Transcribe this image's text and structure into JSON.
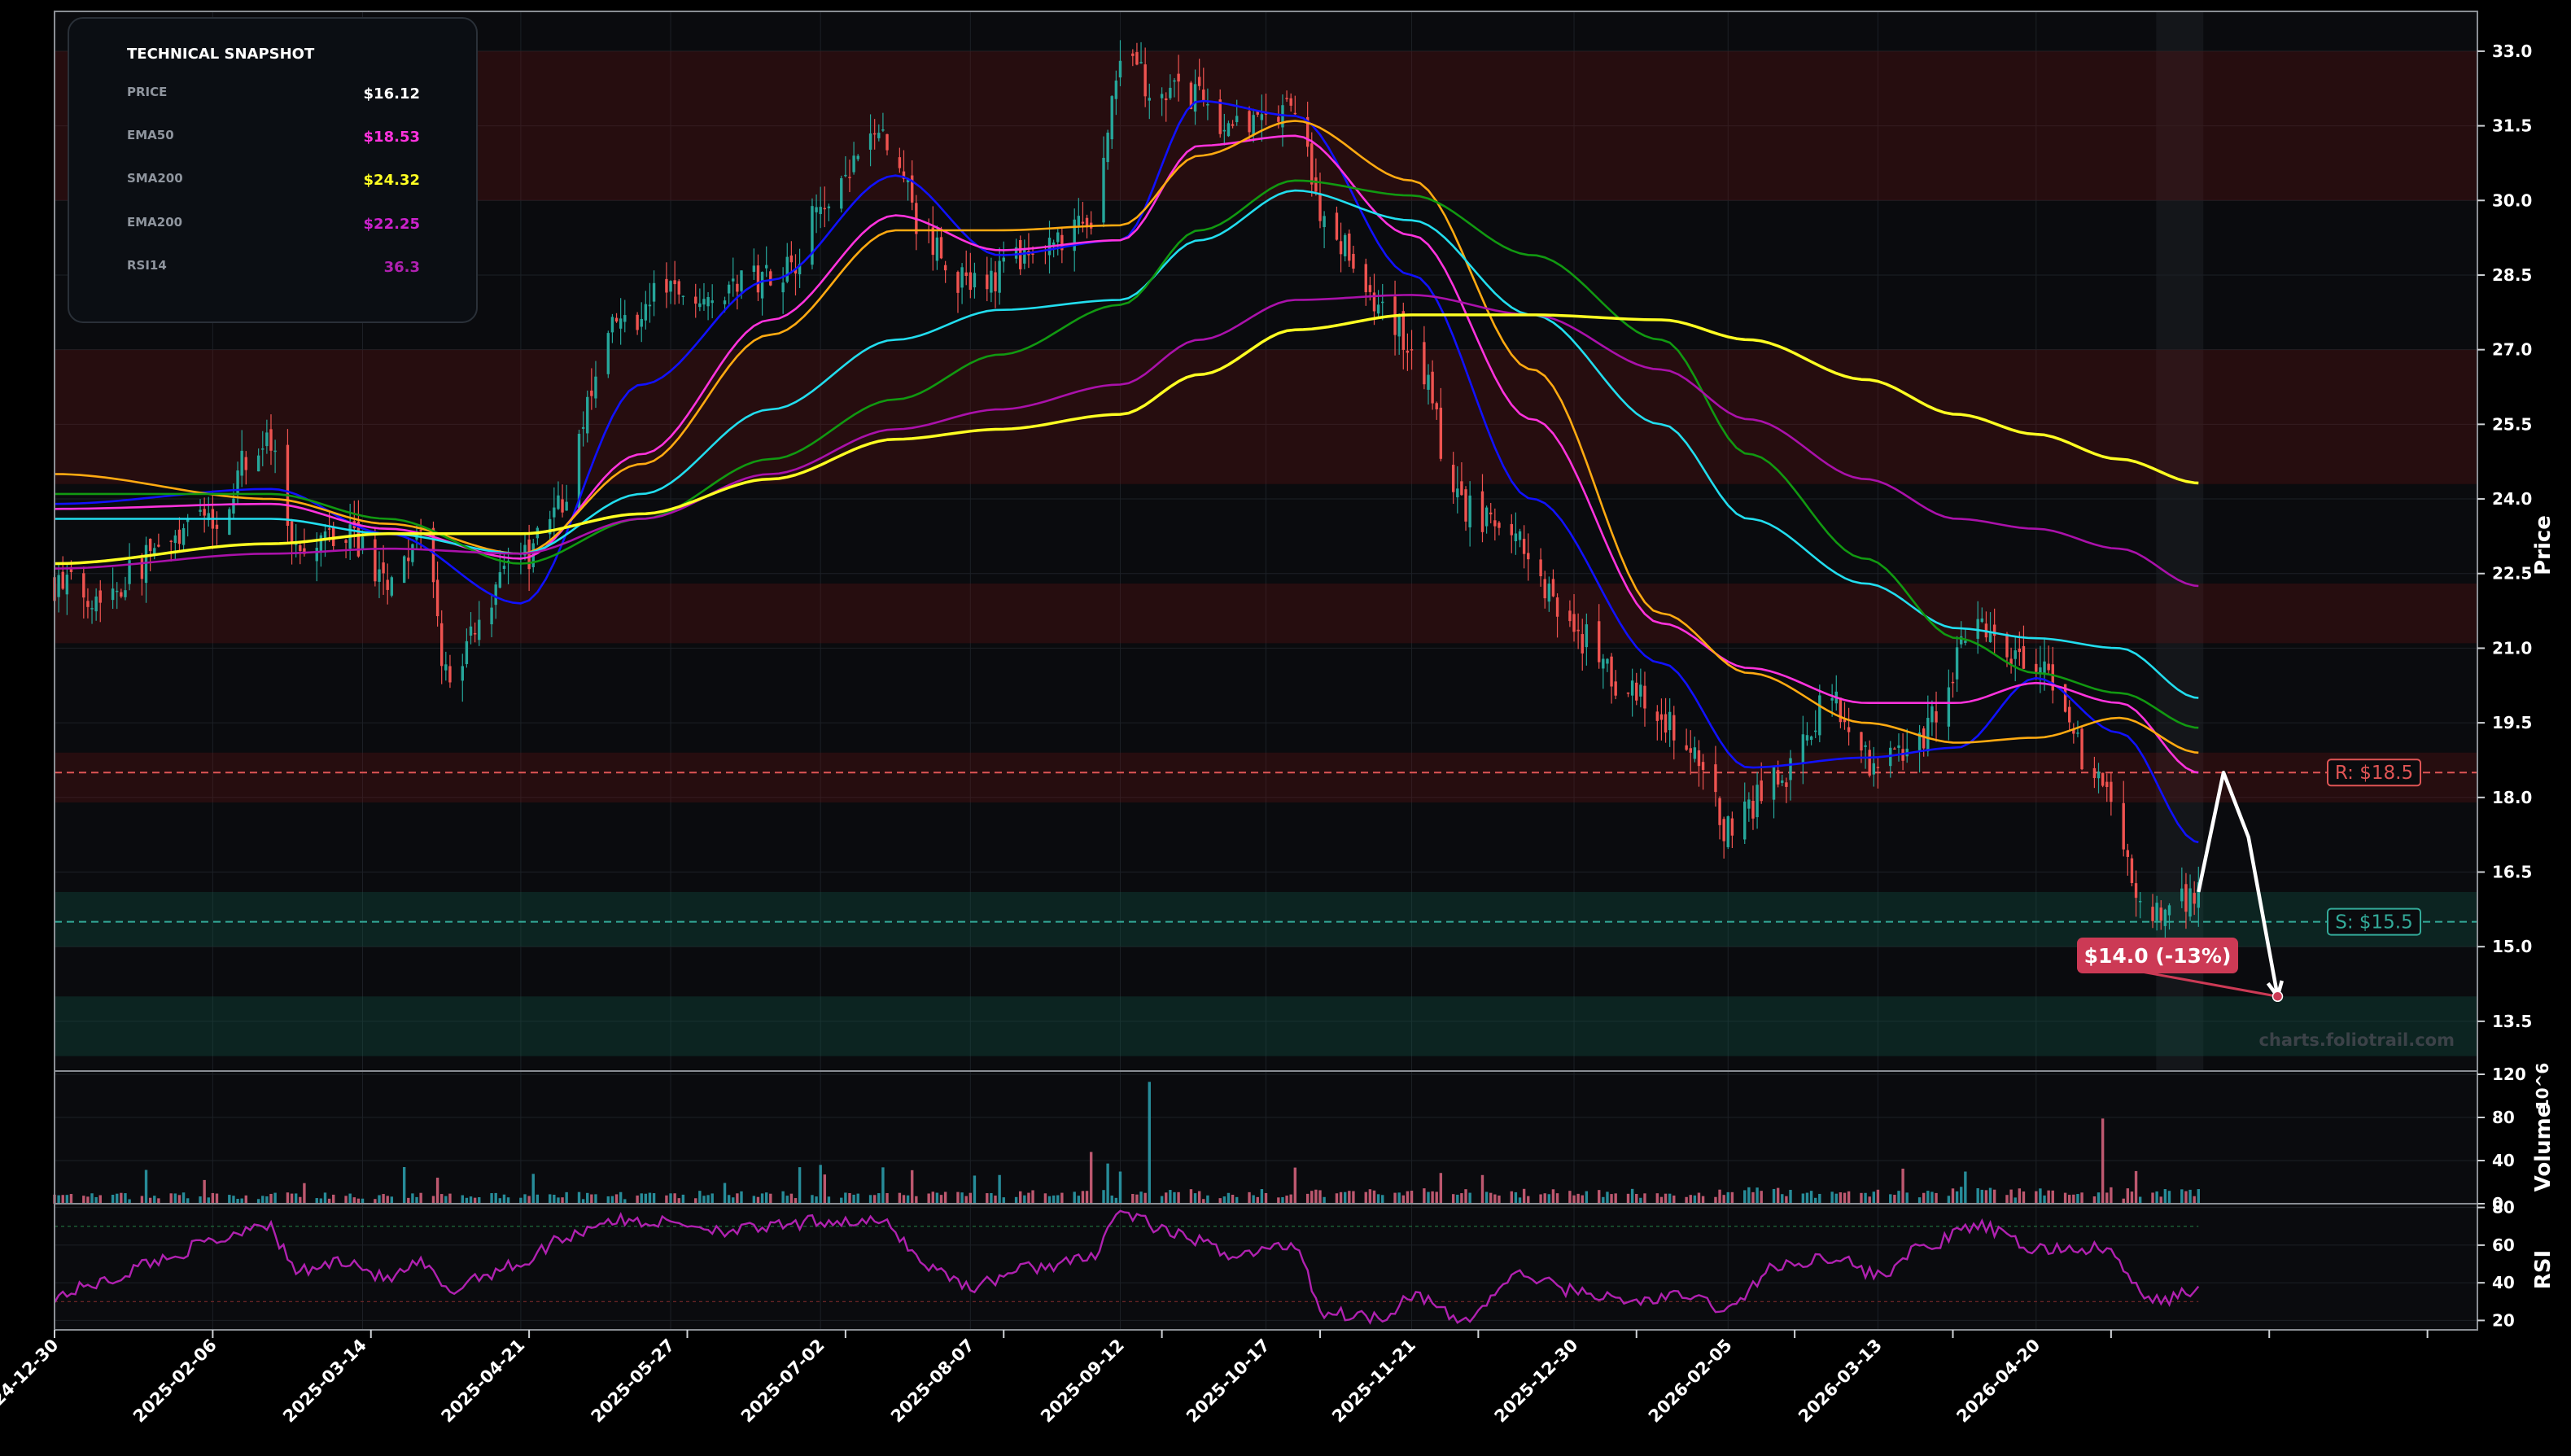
{
  "snapshot": {
    "title": "TECHNICAL SNAPSHOT",
    "rows": [
      {
        "label": "PRICE",
        "value": "$16.12",
        "color": "#ffffff"
      },
      {
        "label": "EMA50",
        "value": "$18.53",
        "color": "#ff33dd"
      },
      {
        "label": "SMA200",
        "value": "$24.32",
        "color": "#ffff22"
      },
      {
        "label": "EMA200",
        "value": "$22.25",
        "color": "#cc22cc"
      },
      {
        "label": "RSI14",
        "value": "36.3",
        "color": "#b021b0"
      }
    ]
  },
  "watermark": "charts.foliotrail.com",
  "chart_data": {
    "type": "candlestick",
    "price_axis": {
      "label": "Price",
      "ylim": [
        12.5,
        33.8
      ],
      "ticks": [
        13.5,
        15.0,
        16.5,
        18.0,
        19.5,
        21.0,
        22.5,
        24.0,
        25.5,
        27.0,
        28.5,
        30.0,
        31.5,
        33.0
      ]
    },
    "volume_axis": {
      "label": "Volume",
      "unit": "10^6",
      "ylim": [
        0,
        120
      ],
      "ticks": [
        0,
        40,
        80,
        120
      ]
    },
    "rsi_axis": {
      "label": "RSI",
      "ylim": [
        15,
        82
      ],
      "ticks": [
        20,
        40,
        60,
        80
      ],
      "guides": [
        30,
        70
      ]
    },
    "x_axis": {
      "start": "2024-12-30",
      "end": "2026-08-04",
      "ticks": [
        "2024-12-30",
        "2025-02-06",
        "2025-03-14",
        "2025-04-21",
        "2025-05-27",
        "2025-07-02",
        "2025-08-07",
        "2025-09-12",
        "2025-10-17",
        "2025-11-21",
        "2025-12-30",
        "2026-02-05",
        "2026-03-13",
        "2026-04-20"
      ]
    },
    "last_date": "2026-05-29",
    "close_path": [
      [
        "2024-12-30",
        22.3
      ],
      [
        "2025-01-10",
        22.1
      ],
      [
        "2025-01-24",
        22.9
      ],
      [
        "2025-02-06",
        23.7
      ],
      [
        "2025-02-18",
        25.2
      ],
      [
        "2025-02-27",
        23.0
      ],
      [
        "2025-03-10",
        23.3
      ],
      [
        "2025-03-20",
        22.4
      ],
      [
        "2025-03-28",
        23.1
      ],
      [
        "2025-04-04",
        20.3
      ],
      [
        "2025-04-11",
        21.6
      ],
      [
        "2025-04-21",
        22.8
      ],
      [
        "2025-05-01",
        24.0
      ],
      [
        "2025-05-12",
        27.3
      ],
      [
        "2025-05-27",
        28.2
      ],
      [
        "2025-06-10",
        28.3
      ],
      [
        "2025-06-24",
        28.7
      ],
      [
        "2025-07-02",
        29.8
      ],
      [
        "2025-07-16",
        31.2
      ],
      [
        "2025-07-30",
        29.0
      ],
      [
        "2025-08-07",
        28.2
      ],
      [
        "2025-08-21",
        28.8
      ],
      [
        "2025-09-04",
        29.4
      ],
      [
        "2025-09-12",
        32.6
      ],
      [
        "2025-09-26",
        32.2
      ],
      [
        "2025-10-10",
        31.4
      ],
      [
        "2025-10-24",
        31.8
      ],
      [
        "2025-10-31",
        29.6
      ],
      [
        "2025-11-14",
        27.8
      ],
      [
        "2025-11-21",
        27.1
      ],
      [
        "2025-12-03",
        23.9
      ],
      [
        "2025-12-17",
        23.1
      ],
      [
        "2025-12-30",
        21.3
      ],
      [
        "2026-01-12",
        20.1
      ],
      [
        "2026-01-26",
        19.2
      ],
      [
        "2026-02-05",
        17.4
      ],
      [
        "2026-02-16",
        18.3
      ],
      [
        "2026-03-02",
        19.9
      ],
      [
        "2026-03-13",
        18.6
      ],
      [
        "2026-03-23",
        19.3
      ],
      [
        "2026-04-06",
        21.3
      ],
      [
        "2026-04-20",
        20.6
      ],
      [
        "2026-05-06",
        18.2
      ],
      [
        "2026-05-18",
        15.6
      ],
      [
        "2026-05-29",
        16.1
      ]
    ],
    "series": [
      {
        "name": "EMA20",
        "color": "#1111ff",
        "points": [
          [
            "2024-12-30",
            23.9
          ],
          [
            "2025-02-20",
            24.2
          ],
          [
            "2025-03-20",
            23.3
          ],
          [
            "2025-04-21",
            21.9
          ],
          [
            "2025-05-20",
            26.3
          ],
          [
            "2025-06-20",
            28.4
          ],
          [
            "2025-07-20",
            30.5
          ],
          [
            "2025-08-14",
            28.9
          ],
          [
            "2025-09-12",
            29.2
          ],
          [
            "2025-10-01",
            32.0
          ],
          [
            "2025-10-24",
            31.7
          ],
          [
            "2025-11-21",
            28.5
          ],
          [
            "2025-12-20",
            24.0
          ],
          [
            "2026-01-20",
            20.7
          ],
          [
            "2026-02-10",
            18.6
          ],
          [
            "2026-03-10",
            18.8
          ],
          [
            "2026-04-01",
            19.0
          ],
          [
            "2026-04-20",
            20.4
          ],
          [
            "2026-05-10",
            19.3
          ],
          [
            "2026-05-29",
            17.1
          ]
        ]
      },
      {
        "name": "EMA30",
        "color": "#ff33dd",
        "points": [
          [
            "2024-12-30",
            23.8
          ],
          [
            "2025-02-20",
            23.9
          ],
          [
            "2025-03-20",
            23.4
          ],
          [
            "2025-04-21",
            22.8
          ],
          [
            "2025-05-20",
            24.9
          ],
          [
            "2025-06-20",
            27.6
          ],
          [
            "2025-07-20",
            29.7
          ],
          [
            "2025-08-14",
            29.0
          ],
          [
            "2025-09-12",
            29.2
          ],
          [
            "2025-10-01",
            31.1
          ],
          [
            "2025-10-24",
            31.3
          ],
          [
            "2025-11-21",
            29.3
          ],
          [
            "2025-12-20",
            25.6
          ],
          [
            "2026-01-20",
            21.5
          ],
          [
            "2026-02-10",
            20.6
          ],
          [
            "2026-03-10",
            19.9
          ],
          [
            "2026-04-01",
            19.9
          ],
          [
            "2026-04-20",
            20.3
          ],
          [
            "2026-05-10",
            19.9
          ],
          [
            "2026-05-29",
            18.5
          ]
        ]
      },
      {
        "name": "EMA35",
        "color": "#ffaa11",
        "points": [
          [
            "2024-12-30",
            24.5
          ],
          [
            "2025-02-20",
            24.0
          ],
          [
            "2025-03-20",
            23.5
          ],
          [
            "2025-04-21",
            22.9
          ],
          [
            "2025-05-20",
            24.7
          ],
          [
            "2025-06-20",
            27.3
          ],
          [
            "2025-07-20",
            29.4
          ],
          [
            "2025-08-14",
            29.4
          ],
          [
            "2025-09-12",
            29.5
          ],
          [
            "2025-10-01",
            30.9
          ],
          [
            "2025-10-24",
            31.6
          ],
          [
            "2025-11-21",
            30.4
          ],
          [
            "2025-12-20",
            26.6
          ],
          [
            "2026-01-20",
            21.7
          ],
          [
            "2026-02-10",
            20.5
          ],
          [
            "2026-03-10",
            19.5
          ],
          [
            "2026-04-01",
            19.1
          ],
          [
            "2026-04-20",
            19.2
          ],
          [
            "2026-05-10",
            19.6
          ],
          [
            "2026-05-29",
            18.9
          ]
        ]
      },
      {
        "name": "EMA50",
        "color": "#22ddee",
        "points": [
          [
            "2024-12-30",
            23.6
          ],
          [
            "2025-02-20",
            23.6
          ],
          [
            "2025-03-20",
            23.3
          ],
          [
            "2025-04-21",
            22.9
          ],
          [
            "2025-05-20",
            24.1
          ],
          [
            "2025-06-20",
            25.8
          ],
          [
            "2025-07-20",
            27.2
          ],
          [
            "2025-08-14",
            27.8
          ],
          [
            "2025-09-12",
            28.0
          ],
          [
            "2025-10-01",
            29.2
          ],
          [
            "2025-10-24",
            30.2
          ],
          [
            "2025-11-21",
            29.6
          ],
          [
            "2025-12-20",
            27.7
          ],
          [
            "2026-01-20",
            25.5
          ],
          [
            "2026-02-10",
            23.6
          ],
          [
            "2026-03-10",
            22.3
          ],
          [
            "2026-04-01",
            21.4
          ],
          [
            "2026-04-20",
            21.2
          ],
          [
            "2026-05-10",
            21.0
          ],
          [
            "2026-05-29",
            20.0
          ]
        ]
      },
      {
        "name": "EMA100",
        "color": "#119911",
        "points": [
          [
            "2024-12-30",
            24.1
          ],
          [
            "2025-02-20",
            24.1
          ],
          [
            "2025-03-20",
            23.6
          ],
          [
            "2025-04-21",
            22.7
          ],
          [
            "2025-05-20",
            23.6
          ],
          [
            "2025-06-20",
            24.8
          ],
          [
            "2025-07-20",
            26.0
          ],
          [
            "2025-08-14",
            26.9
          ],
          [
            "2025-09-12",
            27.9
          ],
          [
            "2025-10-01",
            29.4
          ],
          [
            "2025-10-24",
            30.4
          ],
          [
            "2025-11-21",
            30.1
          ],
          [
            "2025-12-20",
            28.9
          ],
          [
            "2026-01-20",
            27.2
          ],
          [
            "2026-02-10",
            24.9
          ],
          [
            "2026-03-10",
            22.8
          ],
          [
            "2026-04-01",
            21.2
          ],
          [
            "2026-04-20",
            20.5
          ],
          [
            "2026-05-10",
            20.1
          ],
          [
            "2026-05-29",
            19.4
          ]
        ]
      },
      {
        "name": "EMA200",
        "color": "#aa11aa",
        "points": [
          [
            "2024-12-30",
            22.6
          ],
          [
            "2025-02-20",
            22.9
          ],
          [
            "2025-03-20",
            23.0
          ],
          [
            "2025-04-21",
            22.9
          ],
          [
            "2025-05-20",
            23.6
          ],
          [
            "2025-06-20",
            24.5
          ],
          [
            "2025-07-20",
            25.4
          ],
          [
            "2025-08-14",
            25.8
          ],
          [
            "2025-09-12",
            26.3
          ],
          [
            "2025-10-01",
            27.2
          ],
          [
            "2025-10-24",
            28.0
          ],
          [
            "2025-11-21",
            28.1
          ],
          [
            "2025-12-20",
            27.7
          ],
          [
            "2026-01-20",
            26.6
          ],
          [
            "2026-02-10",
            25.6
          ],
          [
            "2026-03-10",
            24.4
          ],
          [
            "2026-04-01",
            23.6
          ],
          [
            "2026-04-20",
            23.4
          ],
          [
            "2026-05-10",
            23.0
          ],
          [
            "2026-05-29",
            22.25
          ]
        ]
      },
      {
        "name": "SMA200",
        "color": "#ffff22",
        "width": 3.5,
        "points": [
          [
            "2024-12-30",
            22.7
          ],
          [
            "2025-02-20",
            23.1
          ],
          [
            "2025-03-20",
            23.3
          ],
          [
            "2025-04-21",
            23.3
          ],
          [
            "2025-05-20",
            23.7
          ],
          [
            "2025-06-20",
            24.4
          ],
          [
            "2025-07-20",
            25.2
          ],
          [
            "2025-08-14",
            25.4
          ],
          [
            "2025-09-12",
            25.7
          ],
          [
            "2025-10-01",
            26.5
          ],
          [
            "2025-10-24",
            27.4
          ],
          [
            "2025-11-21",
            27.7
          ],
          [
            "2025-12-20",
            27.7
          ],
          [
            "2026-01-20",
            27.6
          ],
          [
            "2026-02-10",
            27.2
          ],
          [
            "2026-03-10",
            26.4
          ],
          [
            "2026-04-01",
            25.7
          ],
          [
            "2026-04-20",
            25.3
          ],
          [
            "2026-05-10",
            24.8
          ],
          [
            "2026-05-29",
            24.32
          ]
        ]
      }
    ],
    "resistance_zones": [
      [
        30.0,
        33.0
      ],
      [
        24.3,
        27.0
      ],
      [
        21.1,
        22.3
      ],
      [
        17.9,
        18.9
      ]
    ],
    "support_zones": [
      [
        15.0,
        16.1
      ],
      [
        12.8,
        14.0
      ]
    ],
    "resistance": {
      "value": 18.5,
      "label": "R: $18.5",
      "color": "#e05555"
    },
    "support": {
      "value": 15.5,
      "label": "S: $15.5",
      "color": "#33aa99"
    },
    "projection": {
      "color": "#ffffff",
      "points": [
        [
          "2026-05-29",
          16.1
        ],
        [
          "2026-06-04",
          18.5
        ],
        [
          "2026-06-10",
          17.2
        ],
        [
          "2026-06-17",
          14.0
        ]
      ],
      "target": {
        "date": "2026-06-17",
        "value": 14.0,
        "label": "$14.0 (-13%)",
        "color": "#cc3a55"
      }
    },
    "volume_spikes": [
      [
        "2025-09-19",
        113
      ],
      [
        "2026-05-06",
        79
      ],
      [
        "2025-09-05",
        48
      ],
      [
        "2025-07-02",
        36
      ],
      [
        "2026-02-01",
        58
      ],
      [
        "2026-03-01",
        55
      ]
    ],
    "rsi_path": [
      [
        "2024-12-30",
        33
      ],
      [
        "2025-01-10",
        40
      ],
      [
        "2025-01-24",
        52
      ],
      [
        "2025-02-06",
        62
      ],
      [
        "2025-02-18",
        72
      ],
      [
        "2025-02-27",
        46
      ],
      [
        "2025-03-10",
        52
      ],
      [
        "2025-03-20",
        42
      ],
      [
        "2025-03-28",
        50
      ],
      [
        "2025-04-04",
        35
      ],
      [
        "2025-04-11",
        44
      ],
      [
        "2025-04-21",
        50
      ],
      [
        "2025-05-01",
        64
      ],
      [
        "2025-05-12",
        73
      ],
      [
        "2025-05-27",
        72
      ],
      [
        "2025-06-10",
        68
      ],
      [
        "2025-06-24",
        70
      ],
      [
        "2025-07-02",
        73
      ],
      [
        "2025-07-16",
        72
      ],
      [
        "2025-07-30",
        47
      ],
      [
        "2025-08-07",
        38
      ],
      [
        "2025-08-21",
        48
      ],
      [
        "2025-09-04",
        52
      ],
      [
        "2025-09-12",
        77
      ],
      [
        "2025-09-26",
        65
      ],
      [
        "2025-10-10",
        55
      ],
      [
        "2025-10-24",
        60
      ],
      [
        "2025-10-31",
        24
      ],
      [
        "2025-11-14",
        22
      ],
      [
        "2025-11-21",
        34
      ],
      [
        "2025-12-03",
        20
      ],
      [
        "2025-12-17",
        44
      ],
      [
        "2025-12-30",
        36
      ],
      [
        "2026-01-12",
        30
      ],
      [
        "2026-01-26",
        33
      ],
      [
        "2026-02-05",
        26
      ],
      [
        "2026-02-16",
        48
      ],
      [
        "2026-03-02",
        54
      ],
      [
        "2026-03-13",
        44
      ],
      [
        "2026-03-23",
        58
      ],
      [
        "2026-04-06",
        70
      ],
      [
        "2026-04-20",
        58
      ],
      [
        "2026-05-06",
        58
      ],
      [
        "2026-05-18",
        30
      ],
      [
        "2026-05-29",
        36.3
      ]
    ]
  }
}
